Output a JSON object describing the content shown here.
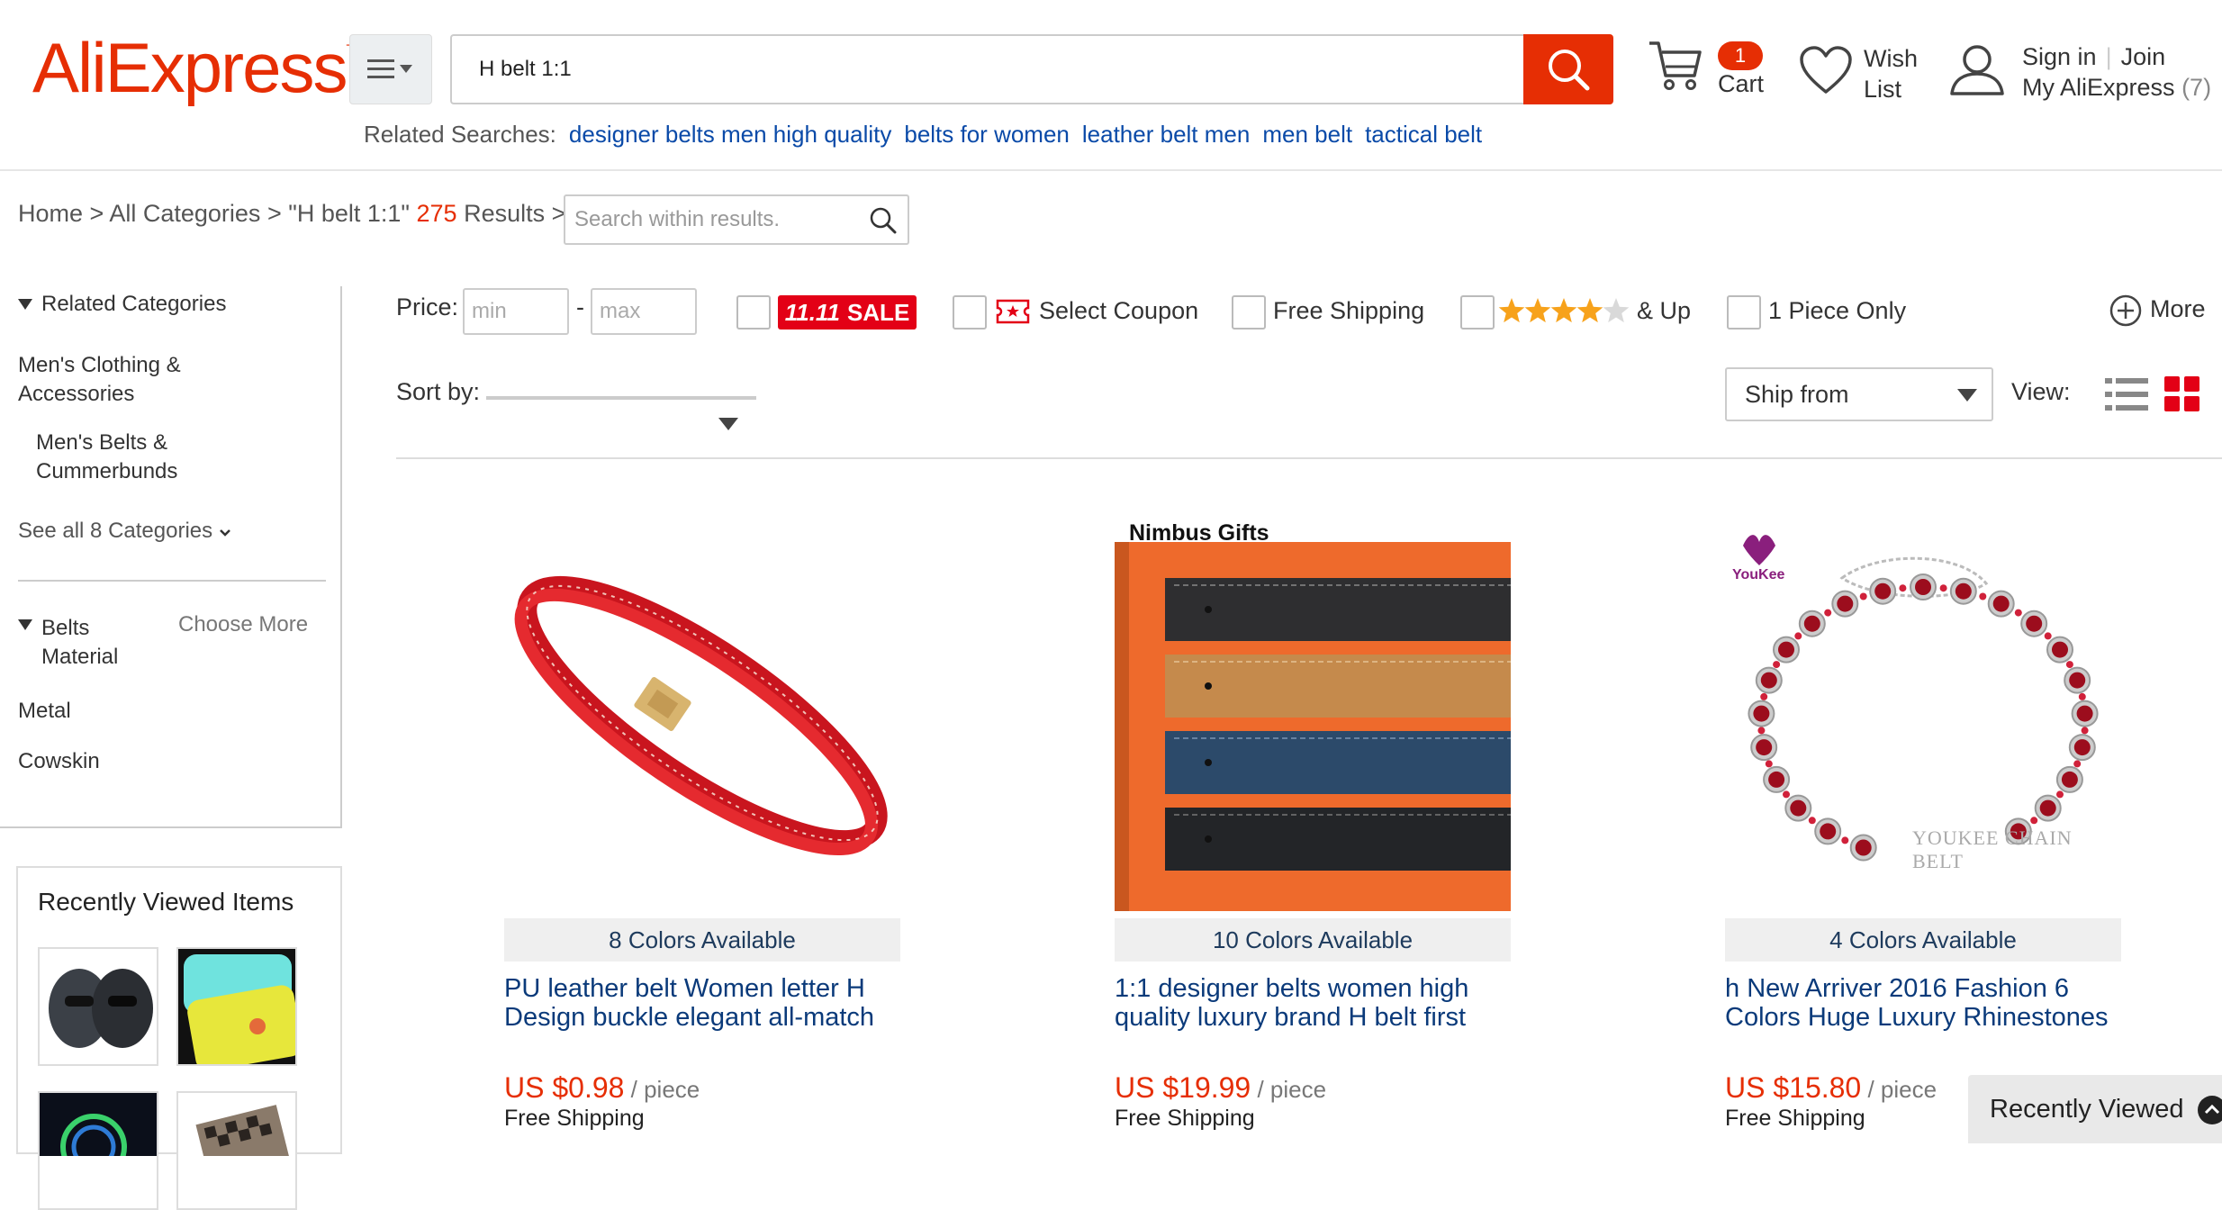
{
  "header": {
    "logo": "AliExpress",
    "logo_tm": "TM",
    "search_value": "H belt  1:1",
    "related_label": "Related Searches:",
    "related": [
      "designer belts men high quality",
      "belts for women",
      "leather belt men",
      "men belt",
      "tactical belt"
    ],
    "cart_count": "1",
    "cart_label": "Cart",
    "wish_label_1": "Wish",
    "wish_label_2": "List",
    "sign_in": "Sign in",
    "join": "Join",
    "my_ae": "My AliExpress",
    "my_ae_count": "(7)"
  },
  "breadcrumb": {
    "home": "Home",
    "sep": ">",
    "all": "All Categories",
    "query": "\"H belt 1:1\"",
    "count": "275",
    "results": "Results",
    "within_placeholder": "Search within results."
  },
  "sidebar": {
    "related_title": "Related Categories",
    "cat1_line1": "Men's Clothing &",
    "cat1_line2": "Accessories",
    "cat2_line1": "Men's Belts &",
    "cat2_line2": "Cummerbunds",
    "see_all": "See all 8 Categories",
    "material_title1": "Belts",
    "material_title2": "Material",
    "choose_more": "Choose More",
    "materials": [
      "Metal",
      "Cowskin"
    ],
    "recent_title": "Recently Viewed Items"
  },
  "filters": {
    "price_label": "Price:",
    "min_placeholder": "min",
    "dash": "-",
    "max_placeholder": "max",
    "sale_num": "11.11",
    "sale_word": "SALE",
    "coupon": "Select Coupon",
    "free_shipping": "Free Shipping",
    "rating": 4,
    "and_up": "& Up",
    "one_piece": "1 Piece Only",
    "more": "More",
    "sort_label": "Sort by:",
    "ship_from": "Ship from",
    "view_label": "View:"
  },
  "products": [
    {
      "colors": "8 Colors Available",
      "title_1": "PU leather ",
      "title_2": "belt",
      "title_3": " Women letter ",
      "title_4": "H",
      "title_5": " Design buckle elegant all-match",
      "price": "US $0.98",
      "unit": " / piece",
      "ship": "Free Shipping"
    },
    {
      "colors": "10 Colors Available",
      "brand": "Nimbus Gifts",
      "title_1": "1:1 designer ",
      "title_2": "belts",
      "title_3": " women high quality luxury brand ",
      "title_4": "H belt",
      "title_5": " first",
      "price": "US $19.99",
      "unit": " / piece",
      "ship": "Free Shipping"
    },
    {
      "colors": "4 Colors Available",
      "brand": "YouKee",
      "watermark": "YOUKEE CHAIN BELT",
      "title_1": "",
      "title_2": "h",
      "title_3": " New Arriver 2016 Fashion 6 Colors Huge Luxury Rhinestones",
      "title_4": "",
      "title_5": "",
      "price": "US $15.80",
      "unit": " / piece",
      "ship": "Free Shipping"
    }
  ],
  "recently_viewed_tab": "Recently Viewed",
  "colors": {
    "accent": "#e62e04",
    "link": "#0a4aa8"
  }
}
